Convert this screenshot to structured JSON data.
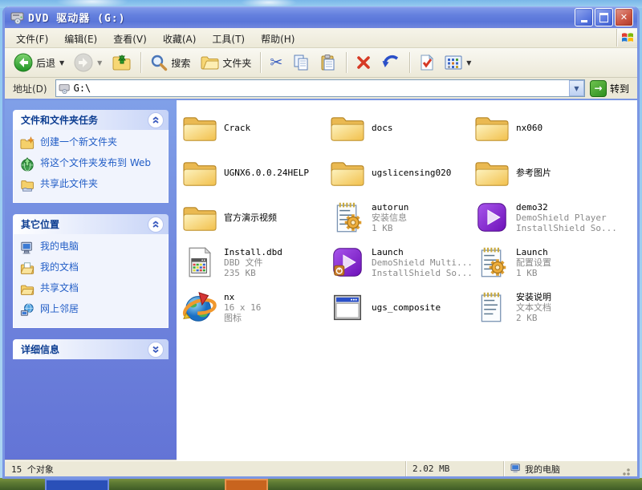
{
  "window": {
    "title": "DVD 驱动器 (G:)",
    "controls": {
      "minimize": "minimize",
      "maximize": "maximize",
      "close": "close"
    }
  },
  "menu": {
    "items": [
      "文件(F)",
      "编辑(E)",
      "查看(V)",
      "收藏(A)",
      "工具(T)",
      "帮助(H)"
    ]
  },
  "toolbar": {
    "back_label": "后退",
    "search_label": "搜索",
    "folders_label": "文件夹"
  },
  "address": {
    "label": "地址(D)",
    "value": "G:\\",
    "go_label": "转到"
  },
  "sidebar": {
    "panels": [
      {
        "title": "文件和文件夹任务",
        "collapsed": false,
        "items": [
          {
            "label": "创建一个新文件夹",
            "icon": "new-folder"
          },
          {
            "label": "将这个文件夹发布到 Web",
            "icon": "publish-web"
          },
          {
            "label": "共享此文件夹",
            "icon": "share-folder"
          }
        ]
      },
      {
        "title": "其它位置",
        "collapsed": false,
        "items": [
          {
            "label": "我的电脑",
            "icon": "computer"
          },
          {
            "label": "我的文档",
            "icon": "my-documents"
          },
          {
            "label": "共享文档",
            "icon": "shared-documents"
          },
          {
            "label": "网上邻居",
            "icon": "network"
          }
        ]
      },
      {
        "title": "详细信息",
        "collapsed": true,
        "items": []
      }
    ]
  },
  "files": {
    "items": [
      {
        "name": "Crack",
        "lines": [],
        "icon": "folder"
      },
      {
        "name": "docs",
        "lines": [],
        "icon": "folder"
      },
      {
        "name": "nx060",
        "lines": [],
        "icon": "folder"
      },
      {
        "name": "UGNX6.0.0.24HELP",
        "lines": [],
        "icon": "folder"
      },
      {
        "name": "ugslicensing020",
        "lines": [],
        "icon": "folder"
      },
      {
        "name": "参考图片",
        "lines": [],
        "icon": "folder"
      },
      {
        "name": "官方演示视频",
        "lines": [],
        "icon": "folder"
      },
      {
        "name": "autorun",
        "lines": [
          "安装信息",
          "1 KB"
        ],
        "icon": "config"
      },
      {
        "name": "demo32",
        "lines": [
          "DemoShield Player",
          "InstallShield So..."
        ],
        "icon": "demoshield"
      },
      {
        "name": "Install.dbd",
        "lines": [
          "DBD 文件",
          "235 KB"
        ],
        "icon": "dbd"
      },
      {
        "name": "Launch",
        "lines": [
          "DemoShield Multi...",
          "InstallShield So..."
        ],
        "icon": "demoshield-power"
      },
      {
        "name": "Launch",
        "lines": [
          "配置设置",
          "1 KB"
        ],
        "icon": "config"
      },
      {
        "name": "nx",
        "lines": [
          "16 x 16",
          "图标"
        ],
        "icon": "nx-icon"
      },
      {
        "name": "ugs_composite",
        "lines": [],
        "icon": "window-file"
      },
      {
        "name": "安装说明",
        "lines": [
          "文本文档",
          "2 KB"
        ],
        "icon": "notepad"
      }
    ]
  },
  "statusbar": {
    "objects": "15 个对象",
    "size": "2.02 MB",
    "zone": "我的电脑"
  }
}
